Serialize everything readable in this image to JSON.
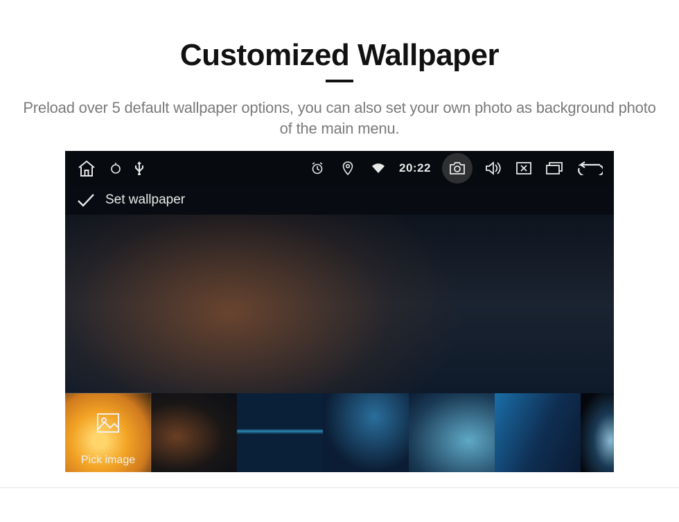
{
  "page": {
    "title": "Customized Wallpaper",
    "description": "Preload over 5 default wallpaper options, you can also set your own photo as background photo of the main menu."
  },
  "status": {
    "time": "20:22"
  },
  "header": {
    "set_wallpaper_label": "Set wallpaper"
  },
  "thumbs": {
    "pick_label": "Pick image"
  }
}
